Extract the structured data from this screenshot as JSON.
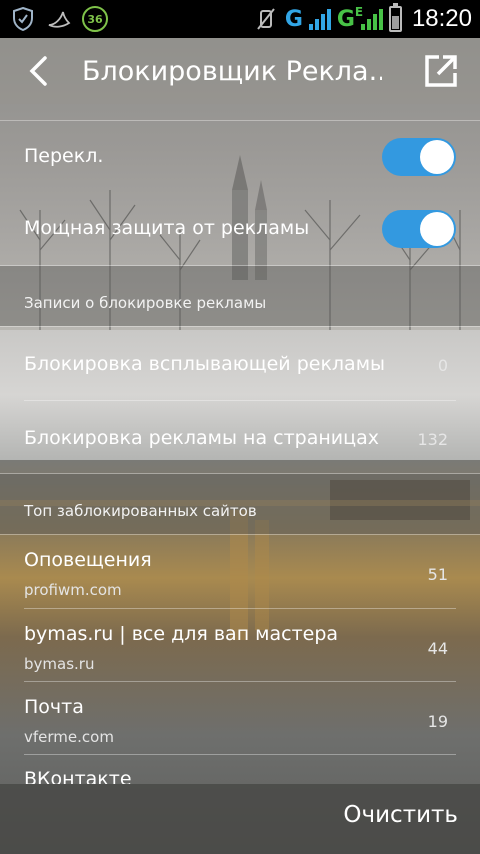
{
  "status_bar": {
    "icons": [
      "shield-icon",
      "swoosh-icon",
      "badge-36-icon",
      "vibrate-off-icon",
      "signal-g-icon",
      "signal-ge-icon",
      "battery-charging-icon"
    ],
    "badge_text": "36",
    "network_1": "G",
    "network_2": "G",
    "network_2_sub": "E",
    "time": "18:20"
  },
  "action_bar": {
    "back_icon": "back-arrow-icon",
    "title": "Блокировщик Рекла...",
    "share_icon": "open-external-icon"
  },
  "settings": {
    "toggle_1_label": "Перекл.",
    "toggle_1_on": true,
    "toggle_2_label": "Мощная защита от рекламы",
    "toggle_2_on": true
  },
  "records": {
    "header": "Записи о блокировке рекламы",
    "items": [
      {
        "label": "Блокировка всплывающей рекламы",
        "count": "0"
      },
      {
        "label": "Блокировка рекламы на страницах",
        "count": "132"
      }
    ]
  },
  "top_sites": {
    "header": "Топ заблокированных сайтов",
    "items": [
      {
        "title": "Оповещения",
        "url": "profiwm.com",
        "count": "51"
      },
      {
        "title": "bymas.ru | все для вап мастера",
        "url": "bymas.ru",
        "count": "44"
      },
      {
        "title": "Почта",
        "url": "vferme.com",
        "count": "19"
      },
      {
        "title": "ВКонтакте",
        "url": "",
        "count": ""
      }
    ]
  },
  "bottom_bar": {
    "clear_label": "Очистить"
  },
  "colors": {
    "toggle_on": "#3399e0",
    "status_bar_bg": "#000000",
    "network_blue": "#32a6e6",
    "network_green": "#48c247"
  }
}
